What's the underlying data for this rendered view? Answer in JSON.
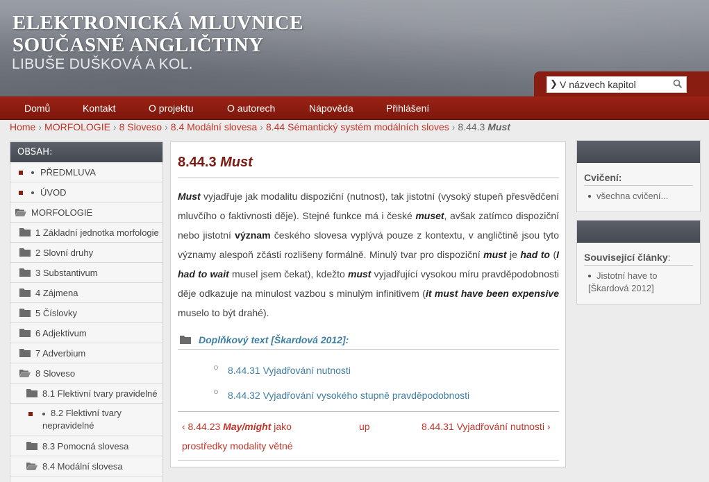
{
  "header": {
    "title_line1": "ELEKTRONICKÁ MLUVNICE",
    "title_line2": "SOUČASNÉ ANGLIČTINY",
    "subtitle": "LIBUŠE DUŠKOVÁ A KOL.",
    "search_value": "V názvech kapitol",
    "search_icon": "magnifier-icon"
  },
  "nav": {
    "items": [
      "Domů",
      "Kontakt",
      "O projektu",
      "O autorech",
      "Nápověda",
      "Přihlášení"
    ]
  },
  "breadcrumb": {
    "links": [
      "Home",
      "MORFOLOGIE",
      "8 Sloveso",
      "8.4 Modální slovesa",
      "8.44 Sémantický systém modálních sloves"
    ],
    "current_num": "8.44.3",
    "current_word": "Must",
    "separator": "›"
  },
  "sidebar": {
    "heading": "OBSAH:",
    "items": [
      {
        "label": "PŘEDMLUVA"
      },
      {
        "label": "ÚVOD"
      },
      {
        "label": "MORFOLOGIE"
      },
      {
        "label": "1 Základní jednotka morfologie"
      },
      {
        "label": "2 Slovní druhy"
      },
      {
        "label": "3 Substantivum"
      },
      {
        "label": "4 Zájmena"
      },
      {
        "label": "5 Číslovky"
      },
      {
        "label": "6 Adjektivum"
      },
      {
        "label": "7 Adverbium"
      },
      {
        "label": "8 Sloveso"
      },
      {
        "label": "8.1 Flektivní tvary pravidelné"
      },
      {
        "label": "8.2 Flektivní tvary",
        "label2": "nepravidelné"
      },
      {
        "label": "8.3 Pomocná slovesa"
      },
      {
        "label": "8.4 Modální slovesa"
      }
    ]
  },
  "main": {
    "heading_num": "8.44.3",
    "heading_word": "Must",
    "p": {
      "w1": "Must",
      "t1": " vyjadřuje jak modalitu dispoziční (nutnost), tak jistotní (vysoký stupeň přesvědčení mluvčího o faktivnosti děje). Stejné funkce má i české ",
      "w2": "muset",
      "t2": ", avšak zatímco dispoziční nebo jistotní ",
      "w3": "význam",
      "t3": " českého slovesa vyplývá pouze z kontextu, v angličtině jsou tyto významy alespoň zčásti rozlišeny formálně. Minulý tvar pro dispoziční ",
      "w4": "must",
      "t4": " je ",
      "w5": "had to",
      "t5": " (",
      "w6": "I had to wait",
      "t6": " musel jsem čekat), kdežto ",
      "w7": "must",
      "t7": " vyjadřující vysokou míru pravděpodobnosti děje odkazuje na minulost vazbou s minulým infinitivem (",
      "w8": "it must have been expensive",
      "t8": " muselo to být drahé)."
    },
    "supplement_label": "Doplňkový text [Škardová 2012]:",
    "sub_links": [
      "8.44.31 Vyjadřování nutnosti",
      "8.44.32 Vyjadřování vysokého stupně pravděpodobnosti"
    ],
    "pager": {
      "prev_prefix": "‹ 8.44.23 ",
      "prev_bold": "May/might",
      "prev_suffix": " jako",
      "prev_line2": "prostředky modality větné",
      "up": "up",
      "next": "8.44.31 Vyjadřování nutnosti ›"
    }
  },
  "right": {
    "exercises_heading": "Cvičení:",
    "exercises_link": "všechna cvičení...",
    "related_heading": "Související články",
    "related_colon": ":",
    "related_link_line1": "Jistotní have to",
    "related_link_line2": "[Škardová 2012]"
  },
  "colors": {
    "brand_red": "#8a1d12",
    "link_red": "#c0352a",
    "link_blue": "#3e7fa3",
    "dark_bar": "#4f545c"
  }
}
